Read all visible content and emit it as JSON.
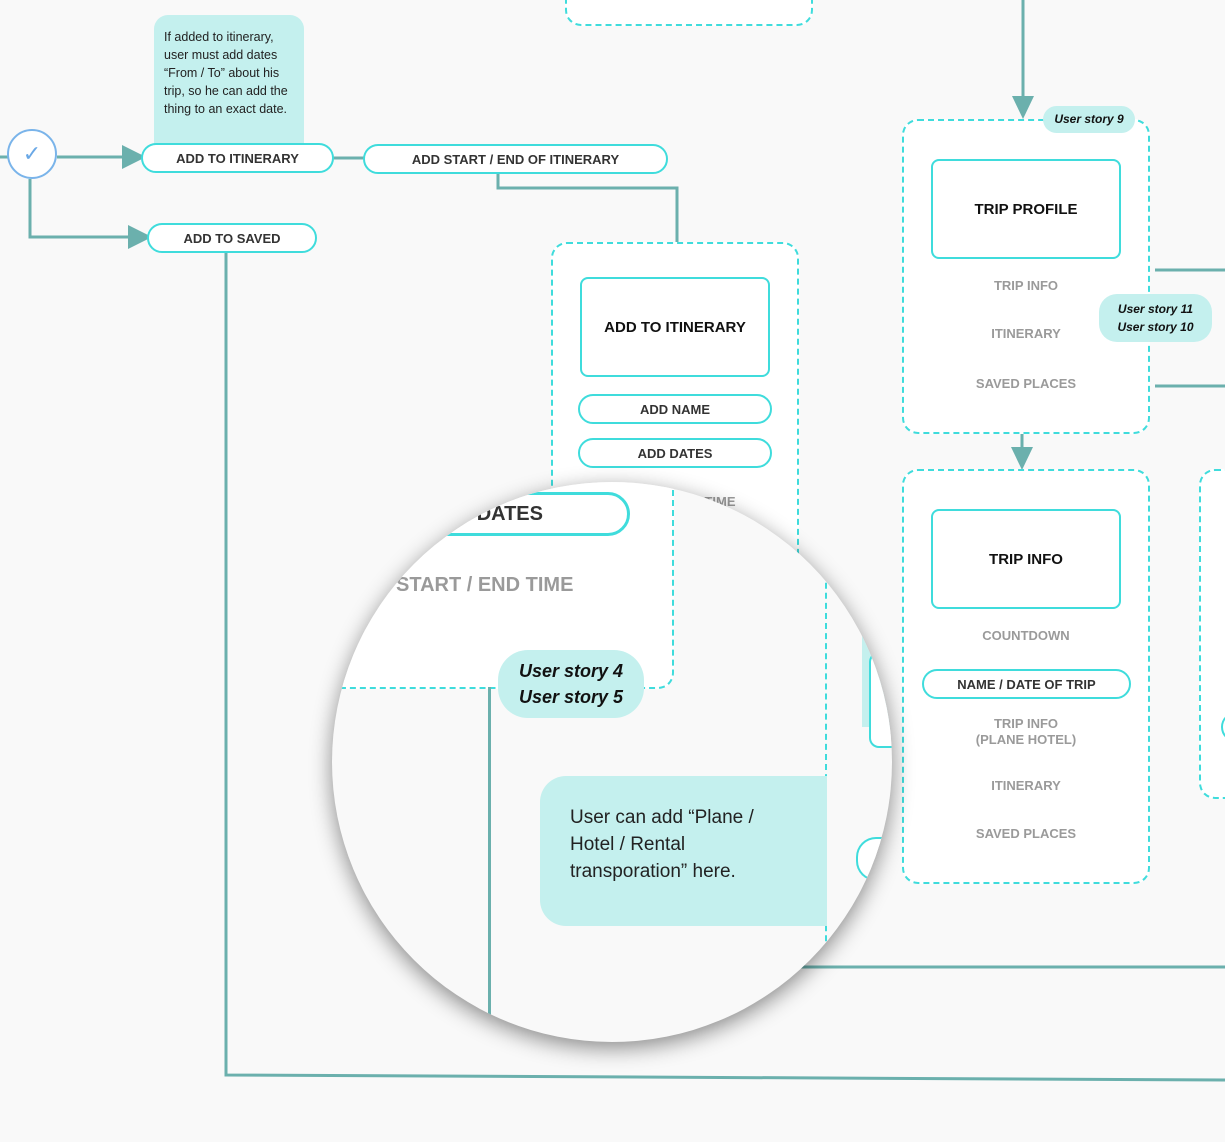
{
  "top_flow": {
    "note": "If added to itinerary, user must add dates “From / To” about his trip, so he can add the thing to an exact date.",
    "decision_icon": "check-icon",
    "add_to_itinerary": "ADD TO ITINERARY",
    "add_start_end": "ADD START / END OF ITINERARY",
    "add_to_saved": "ADD TO SAVED"
  },
  "add_itinerary_screen": {
    "title": "ADD TO ITINERARY",
    "add_name": "ADD NAME",
    "add_dates": "ADD DATES",
    "time_fragment": "TIME"
  },
  "trip_profile_screen": {
    "story_badge": "User story 9",
    "title": "TRIP PROFILE",
    "items": [
      "TRIP INFO",
      "ITINERARY",
      "SAVED PLACES"
    ],
    "side_stories": [
      "User story 11",
      "User story 10"
    ]
  },
  "trip_info_screen": {
    "title": "TRIP INFO",
    "countdown": "COUNTDOWN",
    "name_date": "NAME / DATE OF TRIP",
    "trip_info_line1": "TRIP INFO",
    "trip_info_line2": "(PLANE HOTEL)",
    "itinerary": "ITINERARY",
    "saved_places": "SAVED PLACES"
  },
  "magnifier": {
    "dates_fragment": "DATES",
    "start_end_time": "START / END TIME",
    "stories": [
      "User story 4",
      "User story 5"
    ],
    "note": "User can add “Plane / Hotel / Rental transporation” here."
  },
  "colors": {
    "connector": "#6bb0ad",
    "outline": "#3fdcdc",
    "note_bg": "#c4f0ee",
    "decision": "#7ab4ea",
    "background": "#f9f9f9"
  }
}
